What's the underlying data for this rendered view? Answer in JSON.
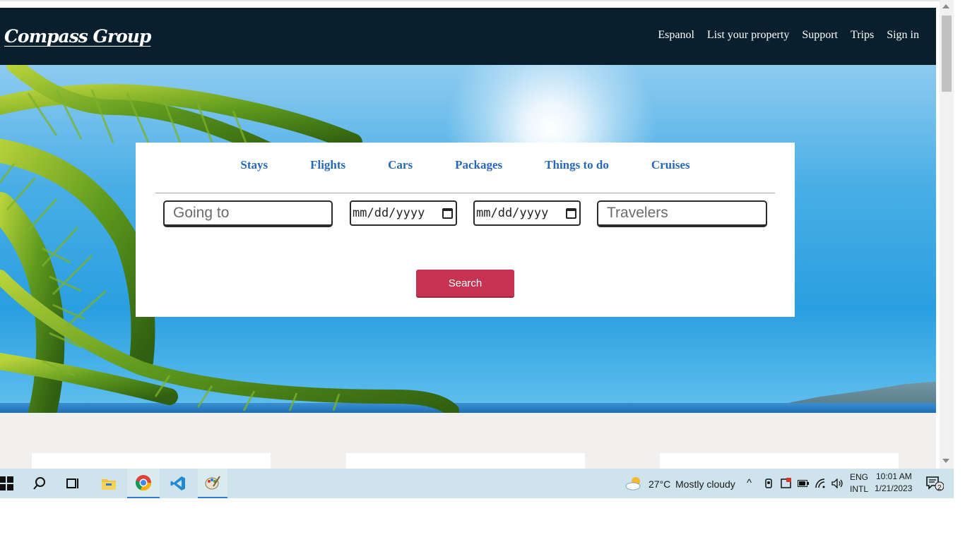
{
  "brand": {
    "logo_text": "Compass Group"
  },
  "nav": {
    "items": [
      "Espanol",
      "List your property",
      "Support",
      "Trips",
      "Sign in"
    ]
  },
  "search": {
    "tabs": [
      "Stays",
      "Flights",
      "Cars",
      "Packages",
      "Things to do",
      "Cruises"
    ],
    "destination_placeholder": "Going to",
    "checkin_placeholder": "mm/dd/yyyy",
    "checkout_placeholder": "mm/dd/yyyy",
    "travelers_placeholder": "Travelers",
    "button_label": "Search"
  },
  "colors": {
    "navbar": "#0a1f2e",
    "tab_text": "#2769b8",
    "search_button": "#c63352",
    "content_bg": "#f1f0ee",
    "taskbar": "#cfe3ec"
  },
  "taskbar": {
    "apps": [
      "start-icon",
      "search-icon",
      "task-view-icon",
      "file-explorer-icon",
      "chrome-icon",
      "vscode-icon",
      "paint-icon"
    ],
    "weather": {
      "temperature": "27°C",
      "condition": "Mostly cloudy"
    },
    "language": {
      "line1": "ENG",
      "line2": "INTL"
    },
    "clock": {
      "time": "10:01 AM",
      "date": "1/21/2023"
    },
    "notification_count": "2"
  }
}
